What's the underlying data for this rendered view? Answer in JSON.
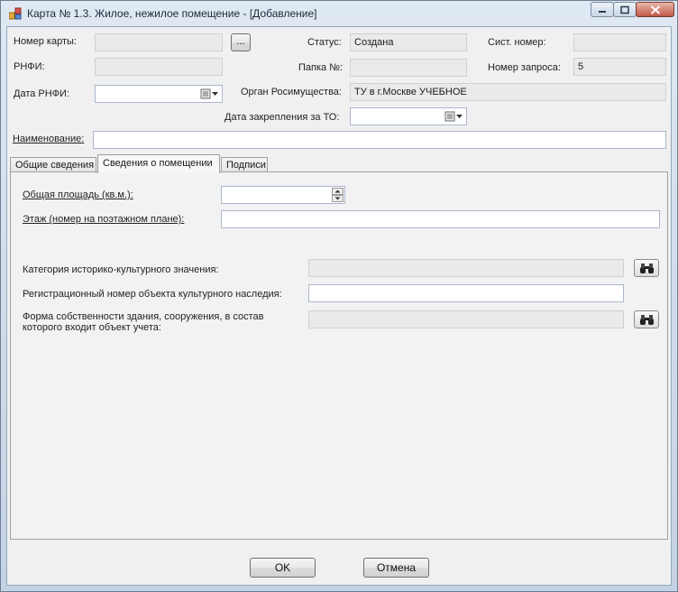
{
  "window": {
    "title": "Карта № 1.3. Жилое, нежилое помещение - [Добавление]"
  },
  "header": {
    "card_number_label": "Номер карты:",
    "card_number_value": "",
    "browse_label": "...",
    "status_label": "Статус:",
    "status_value": "Создана",
    "sys_number_label": "Сист. номер:",
    "sys_number_value": "",
    "rnfi_label": "РНФИ:",
    "rnfi_value": "",
    "folder_label": "Папка №:",
    "folder_value": "",
    "request_number_label": "Номер запроса:",
    "request_number_value": "5",
    "rnfi_date_label": "Дата РНФИ:",
    "rnfi_date_value": "",
    "authority_label": "Орган Росимущества:",
    "authority_value": "ТУ в г.Москве УЧЕБНОЕ",
    "to_date_label": "Дата закрепления за ТО:",
    "to_date_value": "",
    "name_label": "Наименование:",
    "name_value": ""
  },
  "tabs": [
    {
      "label": "Общие сведения",
      "active": false
    },
    {
      "label": "Сведения о помещении",
      "active": true
    },
    {
      "label": "Подписи",
      "active": false
    }
  ],
  "panel": {
    "area_label": "Общая площадь (кв.м.):",
    "area_value": "",
    "floor_label": "Этаж (номер на поэтажном плане):",
    "floor_value": "",
    "category_label": "Категория историко-культурного значения:",
    "category_value": "",
    "reg_number_label": "Регистрационный номер объекта культурного наследия:",
    "reg_number_value": "",
    "ownership_label_line1": "Форма собственности здания, сооружения, в состав",
    "ownership_label_line2": "которого входит объект учета:",
    "ownership_value": ""
  },
  "footer": {
    "ok_label": "OK",
    "cancel_label": "Отмена"
  },
  "colors": {
    "frame": "#c3d2e4",
    "client": "#f0f0f0",
    "disabled_field": "#eaeaea",
    "close_button": "#c0574a"
  },
  "icons": [
    "app-icon",
    "minimize-icon",
    "maximize-icon",
    "close-icon",
    "calendar-icon",
    "chevron-down-icon",
    "spinner-up-icon",
    "spinner-down-icon",
    "binoculars-icon"
  ]
}
